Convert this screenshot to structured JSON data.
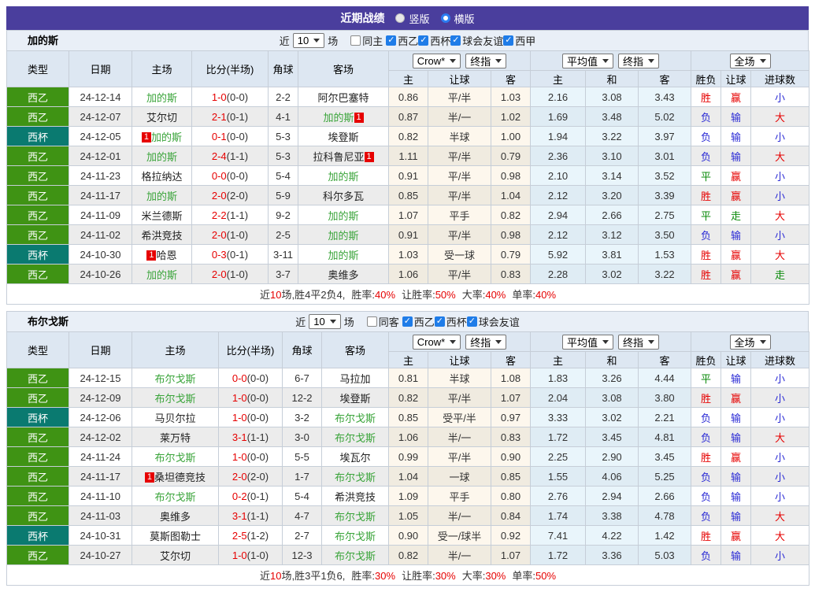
{
  "titlebar": {
    "title": "近期战绩",
    "radios": [
      {
        "label": "竖版",
        "checked": false
      },
      {
        "label": "横版",
        "checked": true
      }
    ]
  },
  "header_cols": {
    "type": "类型",
    "date": "日期",
    "home": "主场",
    "score": "比分(半场)",
    "corner": "角球",
    "away": "客场",
    "sub": [
      "主",
      "让球",
      "客",
      "主",
      "和",
      "客",
      "胜负",
      "让球",
      "进球数"
    ],
    "selects": {
      "group1": [
        "Crow*",
        "终指"
      ],
      "group2": [
        "平均值",
        "终指"
      ],
      "group3": [
        "全场"
      ]
    }
  },
  "filter_labels": {
    "prefix": "近",
    "suffix": "场"
  },
  "icons": {
    "checkbox_check": "✓",
    "dropdown_caret": "triangle-down",
    "radio": "circle"
  },
  "comp_colors": {
    "西乙": "#3f9314",
    "西杯": "#0a7a70"
  },
  "result_colors": {
    "胜": "#e60000",
    "赢": "#e60000",
    "大": "#e60000",
    "负": "#2b2bd5",
    "输": "#2b2bd5",
    "小": "#2b2bd5",
    "平": "#0a8a0a",
    "走": "#0a8a0a"
  },
  "sections": [
    {
      "team": "加的斯",
      "filters": {
        "count": "10",
        "same": {
          "label": "同主",
          "checked": false
        },
        "leagues": [
          {
            "label": "西乙",
            "checked": true
          },
          {
            "label": "西杯",
            "checked": true
          },
          {
            "label": "球会友谊",
            "checked": true
          },
          {
            "label": "西甲",
            "checked": true
          }
        ]
      },
      "rows": [
        {
          "comp": "西乙",
          "date": "24-12-14",
          "home": {
            "name": "加的斯",
            "subject": true
          },
          "ft": "1-0",
          "ht": "(0-0)",
          "corner": "2-2",
          "away": {
            "name": "阿尔巴塞特"
          },
          "odds": [
            "0.86",
            "平/半",
            "1.03"
          ],
          "avg": [
            "2.16",
            "3.08",
            "3.43"
          ],
          "results": [
            "胜",
            "赢",
            "小"
          ]
        },
        {
          "comp": "西乙",
          "date": "24-12-07",
          "home": {
            "name": "艾尔切"
          },
          "ft": "2-1",
          "ht": "(0-1)",
          "corner": "4-1",
          "away": {
            "name": "加的斯",
            "subject": true,
            "rc": "1",
            "rc_pos": "after"
          },
          "odds": [
            "0.87",
            "半/一",
            "1.02"
          ],
          "avg": [
            "1.69",
            "3.48",
            "5.02"
          ],
          "results": [
            "负",
            "输",
            "大"
          ]
        },
        {
          "comp": "西杯",
          "date": "24-12-05",
          "home": {
            "name": "加的斯",
            "subject": true,
            "rc": "1",
            "rc_pos": "before"
          },
          "ft": "0-1",
          "ht": "(0-0)",
          "corner": "5-3",
          "away": {
            "name": "埃登斯"
          },
          "odds": [
            "0.82",
            "半球",
            "1.00"
          ],
          "avg": [
            "1.94",
            "3.22",
            "3.97"
          ],
          "results": [
            "负",
            "输",
            "小"
          ]
        },
        {
          "comp": "西乙",
          "date": "24-12-01",
          "home": {
            "name": "加的斯",
            "subject": true
          },
          "ft": "2-4",
          "ht": "(1-1)",
          "corner": "5-3",
          "away": {
            "name": "拉科鲁尼亚",
            "rc": "1",
            "rc_pos": "after"
          },
          "odds": [
            "1.11",
            "平/半",
            "0.79"
          ],
          "avg": [
            "2.36",
            "3.10",
            "3.01"
          ],
          "results": [
            "负",
            "输",
            "大"
          ]
        },
        {
          "comp": "西乙",
          "date": "24-11-23",
          "home": {
            "name": "格拉纳达"
          },
          "ft": "0-0",
          "ht": "(0-0)",
          "corner": "5-4",
          "away": {
            "name": "加的斯",
            "subject": true
          },
          "odds": [
            "0.91",
            "平/半",
            "0.98"
          ],
          "avg": [
            "2.10",
            "3.14",
            "3.52"
          ],
          "results": [
            "平",
            "赢",
            "小"
          ]
        },
        {
          "comp": "西乙",
          "date": "24-11-17",
          "home": {
            "name": "加的斯",
            "subject": true
          },
          "ft": "2-0",
          "ht": "(2-0)",
          "corner": "5-9",
          "away": {
            "name": "科尔多瓦"
          },
          "odds": [
            "0.85",
            "平/半",
            "1.04"
          ],
          "avg": [
            "2.12",
            "3.20",
            "3.39"
          ],
          "results": [
            "胜",
            "赢",
            "小"
          ]
        },
        {
          "comp": "西乙",
          "date": "24-11-09",
          "home": {
            "name": "米兰德斯"
          },
          "ft": "2-2",
          "ht": "(1-1)",
          "corner": "9-2",
          "away": {
            "name": "加的斯",
            "subject": true
          },
          "odds": [
            "1.07",
            "平手",
            "0.82"
          ],
          "avg": [
            "2.94",
            "2.66",
            "2.75"
          ],
          "results": [
            "平",
            "走",
            "大"
          ]
        },
        {
          "comp": "西乙",
          "date": "24-11-02",
          "home": {
            "name": "希洪竞技"
          },
          "ft": "2-0",
          "ht": "(1-0)",
          "corner": "2-5",
          "away": {
            "name": "加的斯",
            "subject": true
          },
          "odds": [
            "0.91",
            "平/半",
            "0.98"
          ],
          "avg": [
            "2.12",
            "3.12",
            "3.50"
          ],
          "results": [
            "负",
            "输",
            "小"
          ]
        },
        {
          "comp": "西杯",
          "date": "24-10-30",
          "home": {
            "name": "哈恩",
            "rc": "1",
            "rc_pos": "before"
          },
          "ft": "0-3",
          "ht": "(0-1)",
          "corner": "3-11",
          "away": {
            "name": "加的斯",
            "subject": true
          },
          "odds": [
            "1.03",
            "受一球",
            "0.79"
          ],
          "avg": [
            "5.92",
            "3.81",
            "1.53"
          ],
          "results": [
            "胜",
            "赢",
            "大"
          ]
        },
        {
          "comp": "西乙",
          "date": "24-10-26",
          "home": {
            "name": "加的斯",
            "subject": true
          },
          "ft": "2-0",
          "ht": "(1-0)",
          "corner": "3-7",
          "away": {
            "name": "奥维多"
          },
          "odds": [
            "1.06",
            "平/半",
            "0.83"
          ],
          "avg": [
            "2.28",
            "3.02",
            "3.22"
          ],
          "results": [
            "胜",
            "赢",
            "走"
          ]
        }
      ],
      "summary": {
        "prefix": "近",
        "count": "10",
        "record": "场,胜4平2负4,",
        "stats": [
          {
            "label": "胜率:",
            "value": "40%"
          },
          {
            "label": "让胜率:",
            "value": "50%"
          },
          {
            "label": "大率:",
            "value": "40%"
          },
          {
            "label": "单率:",
            "value": "40%"
          }
        ]
      }
    },
    {
      "team": "布尔戈斯",
      "filters": {
        "count": "10",
        "same": {
          "label": "同客",
          "checked": false
        },
        "leagues": [
          {
            "label": "西乙",
            "checked": true
          },
          {
            "label": "西杯",
            "checked": true
          },
          {
            "label": "球会友谊",
            "checked": true
          }
        ]
      },
      "rows": [
        {
          "comp": "西乙",
          "date": "24-12-15",
          "home": {
            "name": "布尔戈斯",
            "subject": true
          },
          "ft": "0-0",
          "ht": "(0-0)",
          "corner": "6-7",
          "away": {
            "name": "马拉加"
          },
          "odds": [
            "0.81",
            "半球",
            "1.08"
          ],
          "avg": [
            "1.83",
            "3.26",
            "4.44"
          ],
          "results": [
            "平",
            "输",
            "小"
          ]
        },
        {
          "comp": "西乙",
          "date": "24-12-09",
          "home": {
            "name": "布尔戈斯",
            "subject": true
          },
          "ft": "1-0",
          "ht": "(0-0)",
          "corner": "12-2",
          "away": {
            "name": "埃登斯"
          },
          "odds": [
            "0.82",
            "平/半",
            "1.07"
          ],
          "avg": [
            "2.04",
            "3.08",
            "3.80"
          ],
          "results": [
            "胜",
            "赢",
            "小"
          ]
        },
        {
          "comp": "西杯",
          "date": "24-12-06",
          "home": {
            "name": "马贝尔拉"
          },
          "ft": "1-0",
          "ht": "(0-0)",
          "corner": "3-2",
          "away": {
            "name": "布尔戈斯",
            "subject": true
          },
          "odds": [
            "0.85",
            "受平/半",
            "0.97"
          ],
          "avg": [
            "3.33",
            "3.02",
            "2.21"
          ],
          "results": [
            "负",
            "输",
            "小"
          ]
        },
        {
          "comp": "西乙",
          "date": "24-12-02",
          "home": {
            "name": "莱万特"
          },
          "ft": "3-1",
          "ht": "(1-1)",
          "corner": "3-0",
          "away": {
            "name": "布尔戈斯",
            "subject": true
          },
          "odds": [
            "1.06",
            "半/一",
            "0.83"
          ],
          "avg": [
            "1.72",
            "3.45",
            "4.81"
          ],
          "results": [
            "负",
            "输",
            "大"
          ]
        },
        {
          "comp": "西乙",
          "date": "24-11-24",
          "home": {
            "name": "布尔戈斯",
            "subject": true
          },
          "ft": "1-0",
          "ht": "(0-0)",
          "corner": "5-5",
          "away": {
            "name": "埃瓦尔"
          },
          "odds": [
            "0.99",
            "平/半",
            "0.90"
          ],
          "avg": [
            "2.25",
            "2.90",
            "3.45"
          ],
          "results": [
            "胜",
            "赢",
            "小"
          ]
        },
        {
          "comp": "西乙",
          "date": "24-11-17",
          "home": {
            "name": "桑坦德竞技",
            "rc": "1",
            "rc_pos": "before"
          },
          "ft": "2-0",
          "ht": "(2-0)",
          "corner": "1-7",
          "away": {
            "name": "布尔戈斯",
            "subject": true
          },
          "odds": [
            "1.04",
            "一球",
            "0.85"
          ],
          "avg": [
            "1.55",
            "4.06",
            "5.25"
          ],
          "results": [
            "负",
            "输",
            "小"
          ]
        },
        {
          "comp": "西乙",
          "date": "24-11-10",
          "home": {
            "name": "布尔戈斯",
            "subject": true
          },
          "ft": "0-2",
          "ht": "(0-1)",
          "corner": "5-4",
          "away": {
            "name": "希洪竞技"
          },
          "odds": [
            "1.09",
            "平手",
            "0.80"
          ],
          "avg": [
            "2.76",
            "2.94",
            "2.66"
          ],
          "results": [
            "负",
            "输",
            "小"
          ]
        },
        {
          "comp": "西乙",
          "date": "24-11-03",
          "home": {
            "name": "奥维多"
          },
          "ft": "3-1",
          "ht": "(1-1)",
          "corner": "4-7",
          "away": {
            "name": "布尔戈斯",
            "subject": true
          },
          "odds": [
            "1.05",
            "半/一",
            "0.84"
          ],
          "avg": [
            "1.74",
            "3.38",
            "4.78"
          ],
          "results": [
            "负",
            "输",
            "大"
          ]
        },
        {
          "comp": "西杯",
          "date": "24-10-31",
          "home": {
            "name": "莫斯图勒士"
          },
          "ft": "2-5",
          "ht": "(1-2)",
          "corner": "2-7",
          "away": {
            "name": "布尔戈斯",
            "subject": true
          },
          "odds": [
            "0.90",
            "受一/球半",
            "0.92"
          ],
          "avg": [
            "7.41",
            "4.22",
            "1.42"
          ],
          "results": [
            "胜",
            "赢",
            "大"
          ]
        },
        {
          "comp": "西乙",
          "date": "24-10-27",
          "home": {
            "name": "艾尔切"
          },
          "ft": "1-0",
          "ht": "(1-0)",
          "corner": "12-3",
          "away": {
            "name": "布尔戈斯",
            "subject": true
          },
          "odds": [
            "0.82",
            "半/一",
            "1.07"
          ],
          "avg": [
            "1.72",
            "3.36",
            "5.03"
          ],
          "results": [
            "负",
            "输",
            "小"
          ]
        }
      ],
      "summary": {
        "prefix": "近",
        "count": "10",
        "record": "场,胜3平1负6,",
        "stats": [
          {
            "label": "胜率:",
            "value": "30%"
          },
          {
            "label": "让胜率:",
            "value": "30%"
          },
          {
            "label": "大率:",
            "value": "30%"
          },
          {
            "label": "单率:",
            "value": "50%"
          }
        ]
      }
    }
  ]
}
